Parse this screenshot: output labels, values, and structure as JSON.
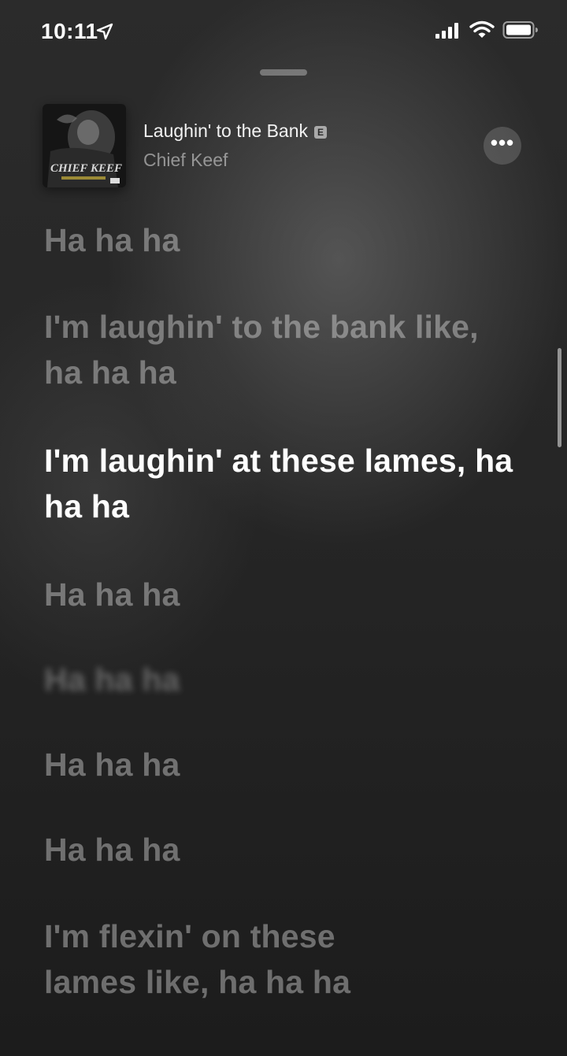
{
  "status_bar": {
    "time": "10:11",
    "icons": [
      "location-arrow-icon",
      "cellular-signal-icon",
      "wifi-icon",
      "battery-icon"
    ]
  },
  "now_playing": {
    "title": "Laughin' to the Bank",
    "explicit_badge": "E",
    "artist": "Chief Keef",
    "album_art_text": "CHIEF KEEF",
    "more_button_label": "•••"
  },
  "lyrics": [
    {
      "text": "Ha ha ha",
      "state": "past"
    },
    {
      "text": "I'm laughin' to the bank like, ha ha ha",
      "state": "past"
    },
    {
      "text": "I'm laughin' at these lames, ha ha ha",
      "state": "active"
    },
    {
      "text": "Ha ha ha",
      "state": "upcoming"
    },
    {
      "text": "Ha ha ha",
      "state": "blurred"
    },
    {
      "text": "Ha ha ha",
      "state": "upcoming"
    },
    {
      "text": "Ha ha ha",
      "state": "upcoming"
    },
    {
      "text": "I'm flexin' on these lames like, ha ha ha",
      "state": "upcoming"
    }
  ],
  "colors": {
    "active_lyric": "#ffffff",
    "inactive_lyric": "#8f8f8f",
    "background": "#262626"
  }
}
